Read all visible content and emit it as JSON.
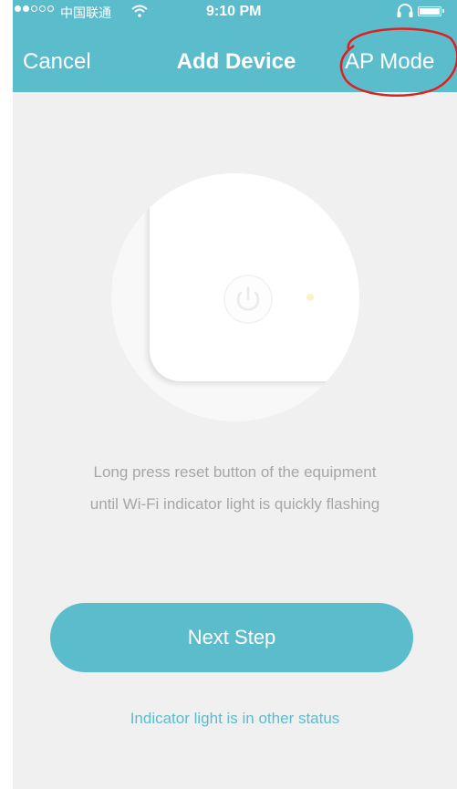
{
  "status_bar": {
    "signal_filled": 2,
    "signal_total": 5,
    "carrier": "中国联通",
    "time": "9:10 PM"
  },
  "nav": {
    "cancel_label": "Cancel",
    "title": "Add Device",
    "ap_mode_label": "AP Mode"
  },
  "instruction": {
    "line1": "Long press reset button of the equipment",
    "line2": "until Wi-Fi indicator light is quickly flashing"
  },
  "next_button_label": "Next Step",
  "other_status_link": "Indicator light is in other status",
  "colors": {
    "accent": "#5bbccc",
    "background": "#f0f0f1",
    "instruction_text": "#a6a6a6",
    "annotation_red": "#e0201c"
  }
}
